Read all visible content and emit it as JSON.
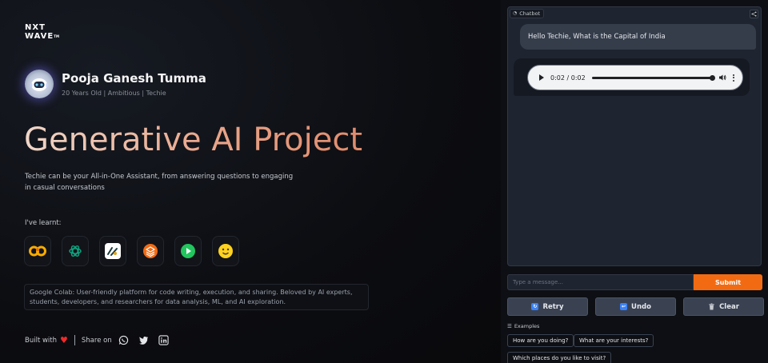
{
  "brand": {
    "line1": "NXT",
    "line2": "WAVE",
    "tm": "TM"
  },
  "profile": {
    "name": "Pooja Ganesh Tumma",
    "tagline": "20 Years Old | Ambitious | Techie"
  },
  "headline": "Generative AI Project",
  "description": "Techie can be your All-in-One Assistant, from answering questions to engaging in casual conversations",
  "learnt_label": "I've learnt:",
  "tools": [
    "google-colab-icon",
    "openai-icon",
    "langchain-icon",
    "stack-icon",
    "play-icon",
    "huggingface-icon"
  ],
  "info_text": "Google Colab: User-friendly platform for code writing, execution, and sharing. Beloved by AI experts, students, developers, and researchers for data analysis, ML, and AI exploration.",
  "footer": {
    "built_with": "Built with",
    "share_on": "Share on"
  },
  "chatbot": {
    "label": "Chatbot",
    "user_message": "Hello Techie, What is the Capital of India",
    "audio_time": "0:02 / 0:02",
    "audio_progress": 1.0
  },
  "input": {
    "placeholder": "Type a message...",
    "submit_label": "Submit"
  },
  "actions": {
    "retry": "Retry",
    "undo": "Undo",
    "clear": "Clear"
  },
  "examples": {
    "label": "Examples",
    "items": [
      "How are you doing?",
      "What are your interests?",
      "Which places do you like to visit?"
    ]
  },
  "colors": {
    "accent": "#f26b13",
    "heart": "#ef2a2a",
    "action_icon": "#3b82f6"
  }
}
